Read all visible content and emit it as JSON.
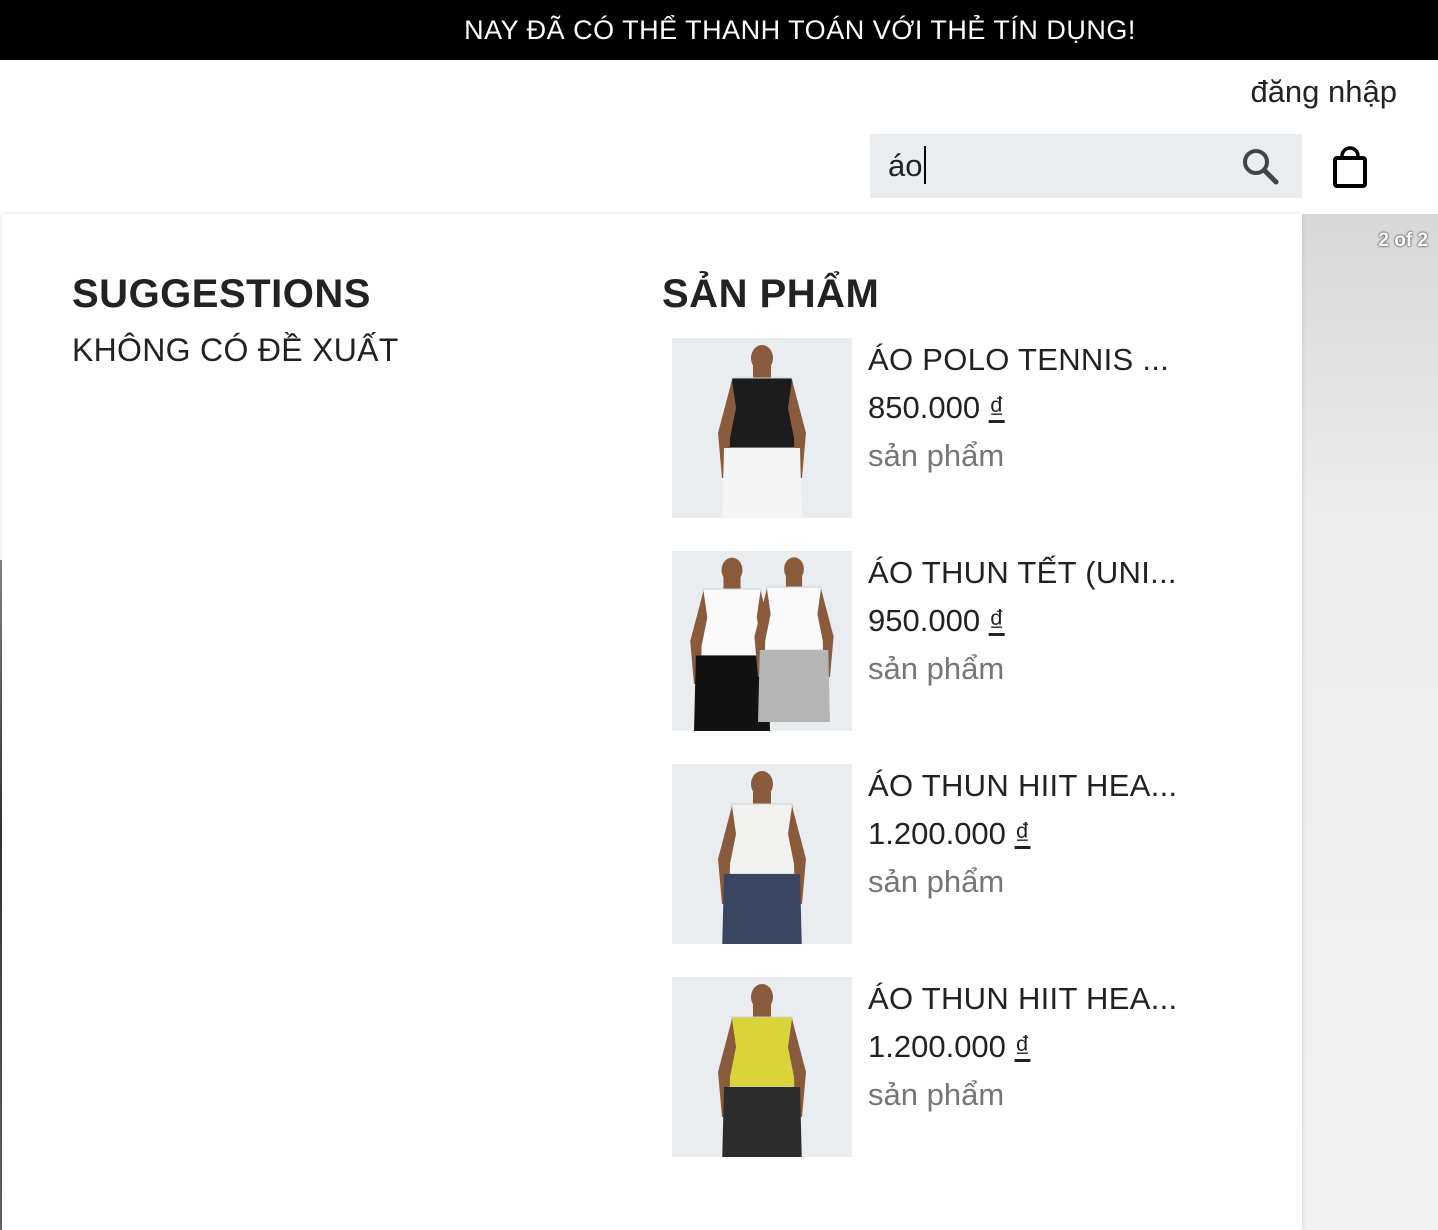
{
  "banner": {
    "text": "NAY ĐÃ CÓ THỂ THANH TOÁN VỚI THẺ TÍN DỤNG!"
  },
  "header": {
    "login_label": "đăng nhập"
  },
  "search": {
    "value": "áo",
    "placeholder": ""
  },
  "carousel": {
    "counter": "2 of 2"
  },
  "suggestions": {
    "heading": "SUGGESTIONS",
    "empty_text": "KHÔNG CÓ ĐỀ XUẤT"
  },
  "products": {
    "heading": "SẢN PHẨM",
    "items": [
      {
        "name": "ÁO POLO TENNIS ...",
        "price": "850.000",
        "currency": "₫",
        "type": "sản phẩm",
        "shirt_color": "#1c1c1c",
        "shorts_color": "#f5f5f5"
      },
      {
        "name": "ÁO THUN TẾT (UNI...",
        "price": "950.000",
        "currency": "₫",
        "type": "sản phẩm",
        "shirt_color": "#fafafa",
        "shorts_color": "#111111"
      },
      {
        "name": "ÁO THUN HIIT HEA...",
        "price": "1.200.000",
        "currency": "₫",
        "type": "sản phẩm",
        "shirt_color": "#f2f2f0",
        "shorts_color": "#3a4660"
      },
      {
        "name": "ÁO THUN HIIT HEA...",
        "price": "1.200.000",
        "currency": "₫",
        "type": "sản phẩm",
        "shirt_color": "#d9d43a",
        "shorts_color": "#2c2c2c"
      }
    ]
  },
  "colors": {
    "banner_bg": "#000000",
    "search_bg": "#e9edf0",
    "thumb_bg": "#e9edf0",
    "secondary_text": "#767676"
  }
}
